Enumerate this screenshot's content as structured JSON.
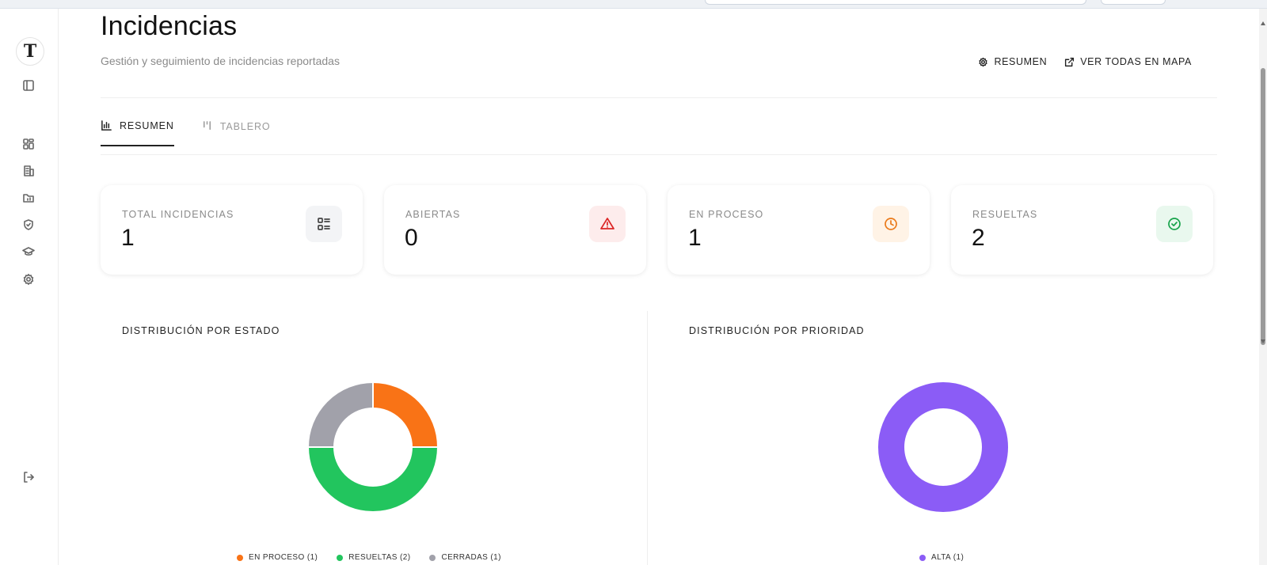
{
  "page": {
    "title": "Incidencias",
    "subtitle": "Gestión y seguimiento de incidencias reportadas"
  },
  "header_actions": [
    {
      "label": "RESUMEN",
      "icon": "gear-icon"
    },
    {
      "label": "VER TODAS EN MAPA",
      "icon": "external-link-icon"
    }
  ],
  "tabs": [
    {
      "label": "RESUMEN",
      "icon": "bar-chart-icon",
      "active": true
    },
    {
      "label": "TABLERO",
      "icon": "kanban-icon",
      "active": false
    }
  ],
  "stats": [
    {
      "label": "TOTAL INCIDENCIAS",
      "value": "1",
      "icon": "list-icon",
      "icon_color": "#444444",
      "bg": "#f3f4f6"
    },
    {
      "label": "ABIERTAS",
      "value": "0",
      "icon": "warning-icon",
      "icon_color": "#dc2626",
      "bg": "#fdecec"
    },
    {
      "label": "EN PROCESO",
      "value": "1",
      "icon": "clock-icon",
      "icon_color": "#ea7a1a",
      "bg": "#fff3e6"
    },
    {
      "label": "RESUELTAS",
      "value": "2",
      "icon": "check-circle-icon",
      "icon_color": "#16a34a",
      "bg": "#e9f8ee"
    }
  ],
  "charts": {
    "estado_title": "DISTRIBUCIÓN POR ESTADO",
    "prioridad_title": "DISTRIBUCIÓN POR PRIORIDAD"
  },
  "chart_data": [
    {
      "type": "pie",
      "title": "DISTRIBUCIÓN POR ESTADO",
      "legend_position": "bottom",
      "categories": [
        "EN PROCESO",
        "RESUELTAS",
        "CERRADAS"
      ],
      "values": [
        1,
        2,
        1
      ],
      "legend_labels": [
        "EN PROCESO (1)",
        "RESUELTAS (2)",
        "CERRADAS (1)"
      ],
      "colors": [
        "#f97316",
        "#22c55e",
        "#a1a1aa"
      ]
    },
    {
      "type": "pie",
      "title": "DISTRIBUCIÓN POR PRIORIDAD",
      "legend_position": "bottom",
      "categories": [
        "ALTA"
      ],
      "values": [
        1
      ],
      "legend_labels": [
        "ALTA (1)"
      ],
      "colors": [
        "#8b5cf6"
      ]
    }
  ],
  "sidebar": {
    "logo": "T",
    "items": [
      {
        "icon": "sidebar-toggle-icon"
      },
      {
        "icon": "dashboard-icon"
      },
      {
        "icon": "building-icon"
      },
      {
        "icon": "folder-icon"
      },
      {
        "icon": "shield-icon"
      },
      {
        "icon": "graduation-cap-icon"
      },
      {
        "icon": "gear-icon"
      },
      {
        "icon": "logout-icon"
      }
    ]
  }
}
